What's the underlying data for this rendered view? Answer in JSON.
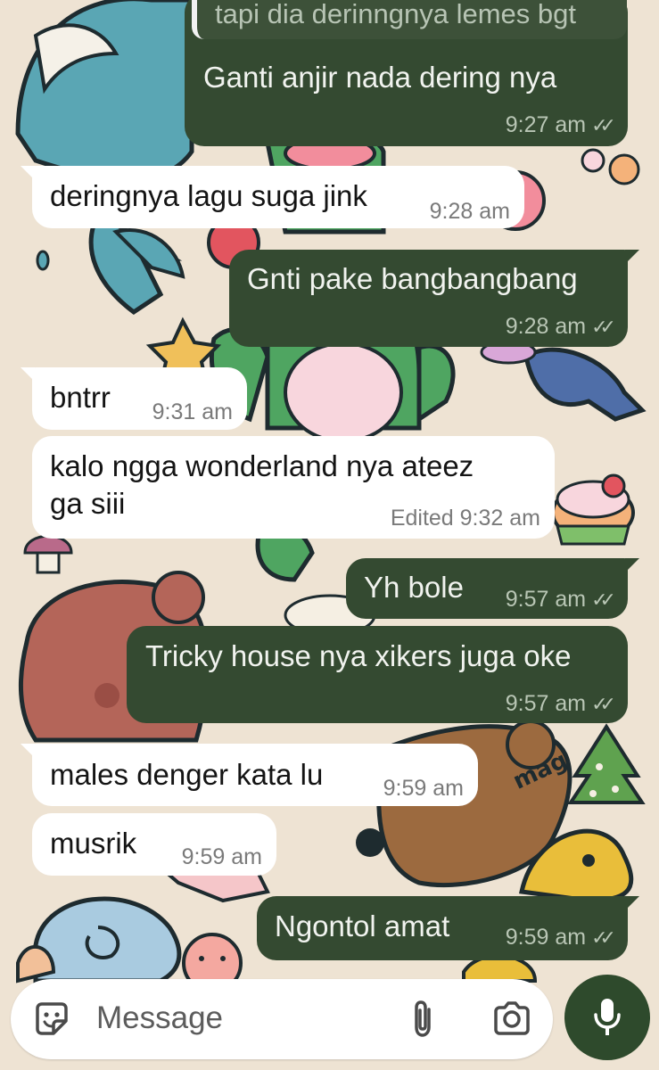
{
  "colors": {
    "wallpaper": "#eee3d3",
    "outgoing_bubble": "#344a31",
    "incoming_bubble": "#ffffff",
    "mic_button": "#2e4a2c"
  },
  "quoted_reply": {
    "text": "tapi dia derinngnya lemes bgt"
  },
  "messages": [
    {
      "direction": "outgoing",
      "text": "Ganti anjir nada dering nya",
      "time": "9:27 am",
      "status": "read"
    },
    {
      "direction": "incoming",
      "text": "deringnya lagu suga jink",
      "time": "9:28 am"
    },
    {
      "direction": "outgoing",
      "text": "Gnti pake bangbangbang",
      "time": "9:28 am",
      "status": "read"
    },
    {
      "direction": "incoming",
      "text": "bntrr",
      "time": "9:31 am"
    },
    {
      "direction": "incoming",
      "text_line1": "kalo ngga wonderland nya ateez",
      "text_line2": "ga siii",
      "edited": "Edited",
      "time": "9:32 am"
    },
    {
      "direction": "outgoing",
      "text": "Yh bole",
      "time": "9:57 am",
      "status": "read"
    },
    {
      "direction": "outgoing",
      "text": "Tricky house nya xikers juga oke",
      "time": "9:57 am",
      "status": "read"
    },
    {
      "direction": "incoming",
      "text": "males denger kata lu",
      "time": "9:59 am"
    },
    {
      "direction": "incoming",
      "text": "musrik",
      "time": "9:59 am"
    },
    {
      "direction": "outgoing",
      "text": "Ngontol amat",
      "time": "9:59 am",
      "status": "read"
    }
  ],
  "ticks_glyph": "✓✓",
  "composer": {
    "placeholder": "Message",
    "icons": [
      "sticker-icon",
      "paperclip-icon",
      "camera-icon",
      "microphone-icon"
    ]
  },
  "wallpaper_text": "mag"
}
